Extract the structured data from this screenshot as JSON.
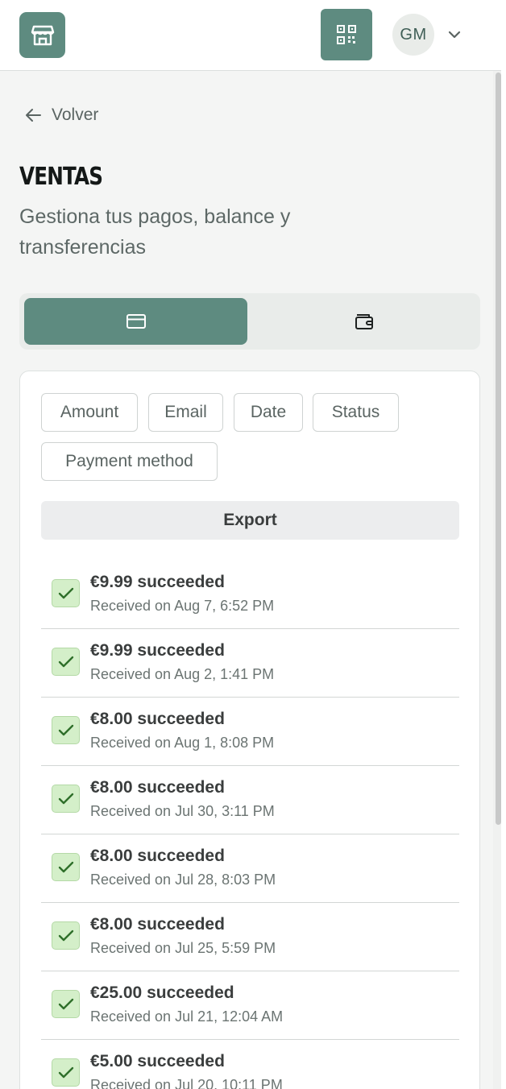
{
  "header": {
    "store_icon": "store-icon",
    "qr_icon": "qr-code-icon",
    "avatar_initials": "GM",
    "menu_icon": "chevron-down-icon"
  },
  "back": {
    "label": "Volver",
    "icon": "arrow-left-icon"
  },
  "page": {
    "title": "VENTAS",
    "subtitle": "Gestiona tus pagos, balance y transferencias"
  },
  "tabs": [
    {
      "icon": "credit-card-icon",
      "active": true
    },
    {
      "icon": "wallet-icon",
      "active": false
    }
  ],
  "filters": [
    "Amount",
    "Email",
    "Date",
    "Status",
    "Payment method"
  ],
  "export_label": "Export",
  "payments": [
    {
      "title": "€9.99 succeeded",
      "received": "Received on Aug 7, 6:52 PM"
    },
    {
      "title": "€9.99 succeeded",
      "received": "Received on Aug 2, 1:41 PM"
    },
    {
      "title": "€8.00 succeeded",
      "received": "Received on Aug 1, 8:08 PM"
    },
    {
      "title": "€8.00 succeeded",
      "received": "Received on Jul 30, 3:11 PM"
    },
    {
      "title": "€8.00 succeeded",
      "received": "Received on Jul 28, 8:03 PM"
    },
    {
      "title": "€8.00 succeeded",
      "received": "Received on Jul 25, 5:59 PM"
    },
    {
      "title": "€25.00 succeeded",
      "received": "Received on Jul 21, 12:04 AM"
    },
    {
      "title": "€5.00 succeeded",
      "received": "Received on Jul 20, 10:11 PM"
    }
  ],
  "colors": {
    "brand": "#5e8b80",
    "success_bg": "#d4efc9",
    "success_check": "#2f6f2a"
  }
}
